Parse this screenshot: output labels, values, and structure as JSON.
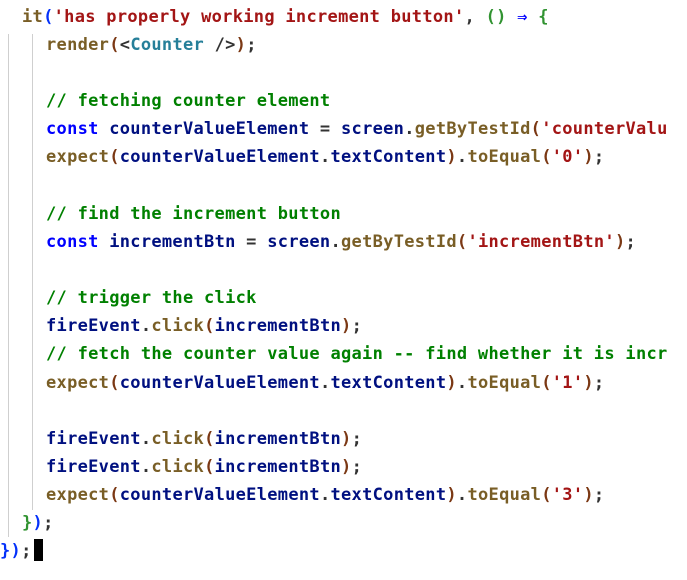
{
  "editor": {
    "lines": [
      {
        "tokens": [
          {
            "text": "it",
            "kind": "fn"
          },
          {
            "text": "(",
            "kind": "br1"
          },
          {
            "text": "'has properly working increment button'",
            "kind": "str"
          },
          {
            "text": ", ",
            "kind": "punc"
          },
          {
            "text": "()",
            "kind": "br2"
          },
          {
            "text": " ⇒ ",
            "kind": "op"
          },
          {
            "text": "{",
            "kind": "br2"
          }
        ]
      },
      {
        "tokens": [
          {
            "text": "render",
            "kind": "fn"
          },
          {
            "text": "(",
            "kind": "br3"
          },
          {
            "text": "<",
            "kind": "punc"
          },
          {
            "text": "Counter",
            "kind": "type"
          },
          {
            "text": " />",
            "kind": "punc"
          },
          {
            "text": ")",
            "kind": "br3"
          },
          {
            "text": ";",
            "kind": "punc"
          }
        ]
      },
      {
        "tokens": []
      },
      {
        "tokens": [
          {
            "text": "// fetching counter element",
            "kind": "com"
          }
        ]
      },
      {
        "tokens": [
          {
            "text": "const ",
            "kind": "kw"
          },
          {
            "text": "counterValueElement",
            "kind": "var"
          },
          {
            "text": " = ",
            "kind": "punc"
          },
          {
            "text": "screen",
            "kind": "var"
          },
          {
            "text": ".",
            "kind": "punc"
          },
          {
            "text": "getByTestId",
            "kind": "fn"
          },
          {
            "text": "(",
            "kind": "br3"
          },
          {
            "text": "'counterValu",
            "kind": "str"
          }
        ]
      },
      {
        "tokens": [
          {
            "text": "expect",
            "kind": "fn"
          },
          {
            "text": "(",
            "kind": "br3"
          },
          {
            "text": "counterValueElement",
            "kind": "var"
          },
          {
            "text": ".",
            "kind": "punc"
          },
          {
            "text": "textContent",
            "kind": "var"
          },
          {
            "text": ")",
            "kind": "br3"
          },
          {
            "text": ".",
            "kind": "punc"
          },
          {
            "text": "toEqual",
            "kind": "fn"
          },
          {
            "text": "(",
            "kind": "br3"
          },
          {
            "text": "'0'",
            "kind": "str"
          },
          {
            "text": ")",
            "kind": "br3"
          },
          {
            "text": ";",
            "kind": "punc"
          }
        ]
      },
      {
        "tokens": []
      },
      {
        "tokens": [
          {
            "text": "// find the increment button",
            "kind": "com"
          }
        ]
      },
      {
        "tokens": [
          {
            "text": "const ",
            "kind": "kw"
          },
          {
            "text": "incrementBtn",
            "kind": "var"
          },
          {
            "text": " = ",
            "kind": "punc"
          },
          {
            "text": "screen",
            "kind": "var"
          },
          {
            "text": ".",
            "kind": "punc"
          },
          {
            "text": "getByTestId",
            "kind": "fn"
          },
          {
            "text": "(",
            "kind": "br3"
          },
          {
            "text": "'incrementBtn'",
            "kind": "str"
          },
          {
            "text": ")",
            "kind": "br3"
          },
          {
            "text": ";",
            "kind": "punc"
          }
        ]
      },
      {
        "tokens": []
      },
      {
        "tokens": [
          {
            "text": "// trigger the click",
            "kind": "com"
          }
        ]
      },
      {
        "tokens": [
          {
            "text": "fireEvent",
            "kind": "var"
          },
          {
            "text": ".",
            "kind": "punc"
          },
          {
            "text": "click",
            "kind": "fn"
          },
          {
            "text": "(",
            "kind": "br3"
          },
          {
            "text": "incrementBtn",
            "kind": "var"
          },
          {
            "text": ")",
            "kind": "br3"
          },
          {
            "text": ";",
            "kind": "punc"
          }
        ]
      },
      {
        "tokens": [
          {
            "text": "// fetch the counter value again -- find whether it is incr",
            "kind": "com"
          }
        ]
      },
      {
        "tokens": [
          {
            "text": "expect",
            "kind": "fn"
          },
          {
            "text": "(",
            "kind": "br3"
          },
          {
            "text": "counterValueElement",
            "kind": "var"
          },
          {
            "text": ".",
            "kind": "punc"
          },
          {
            "text": "textContent",
            "kind": "var"
          },
          {
            "text": ")",
            "kind": "br3"
          },
          {
            "text": ".",
            "kind": "punc"
          },
          {
            "text": "toEqual",
            "kind": "fn"
          },
          {
            "text": "(",
            "kind": "br3"
          },
          {
            "text": "'1'",
            "kind": "str"
          },
          {
            "text": ")",
            "kind": "br3"
          },
          {
            "text": ";",
            "kind": "punc"
          }
        ]
      },
      {
        "tokens": []
      },
      {
        "tokens": [
          {
            "text": "fireEvent",
            "kind": "var"
          },
          {
            "text": ".",
            "kind": "punc"
          },
          {
            "text": "click",
            "kind": "fn"
          },
          {
            "text": "(",
            "kind": "br3"
          },
          {
            "text": "incrementBtn",
            "kind": "var"
          },
          {
            "text": ")",
            "kind": "br3"
          },
          {
            "text": ";",
            "kind": "punc"
          }
        ]
      },
      {
        "tokens": [
          {
            "text": "fireEvent",
            "kind": "var"
          },
          {
            "text": ".",
            "kind": "punc"
          },
          {
            "text": "click",
            "kind": "fn"
          },
          {
            "text": "(",
            "kind": "br3"
          },
          {
            "text": "incrementBtn",
            "kind": "var"
          },
          {
            "text": ")",
            "kind": "br3"
          },
          {
            "text": ";",
            "kind": "punc"
          }
        ]
      },
      {
        "tokens": [
          {
            "text": "expect",
            "kind": "fn"
          },
          {
            "text": "(",
            "kind": "br3"
          },
          {
            "text": "counterValueElement",
            "kind": "var"
          },
          {
            "text": ".",
            "kind": "punc"
          },
          {
            "text": "textContent",
            "kind": "var"
          },
          {
            "text": ")",
            "kind": "br3"
          },
          {
            "text": ".",
            "kind": "punc"
          },
          {
            "text": "toEqual",
            "kind": "fn"
          },
          {
            "text": "(",
            "kind": "br3"
          },
          {
            "text": "'3'",
            "kind": "str"
          },
          {
            "text": ")",
            "kind": "br3"
          },
          {
            "text": ";",
            "kind": "punc"
          }
        ]
      },
      {
        "tokens": [
          {
            "text": "}",
            "kind": "br2"
          },
          {
            "text": ")",
            "kind": "br1"
          },
          {
            "text": ";",
            "kind": "punc"
          }
        ]
      },
      {
        "tokens": [
          {
            "text": "})",
            "kind": "br1"
          },
          {
            "text": ";",
            "kind": "punc"
          }
        ]
      }
    ]
  }
}
